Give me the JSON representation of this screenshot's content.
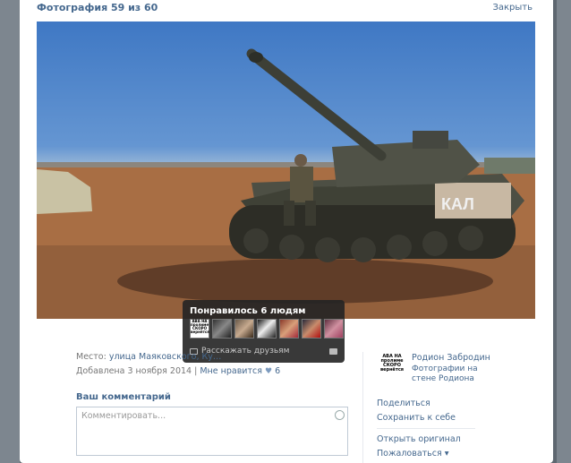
{
  "header": {
    "photo_counter": "Фотография 59 из 60",
    "close_label": "Закрыть"
  },
  "likes_popup": {
    "title": "Понравилось 6 людям",
    "share_label": "Расскажать друзьям",
    "first_avatar_text": "АВА НА пролиме СКОРО вернётся"
  },
  "info": {
    "place_prefix": "Место:",
    "place_value": "улица Маяковского, Ку…",
    "added_label": "Добавлена 3 ноября 2014",
    "separator": "|",
    "like_label": "Мне нравится",
    "like_count": "6"
  },
  "comment": {
    "heading": "Ваш комментарий",
    "placeholder": "Комментировать..."
  },
  "sidebar": {
    "author_name": "Родион Забродин",
    "album_label": "Фотографии на стене Родиона",
    "logo_text": "АВА НА пролиме СКОРО вернётся",
    "share_label": "Поделиться",
    "save_label": "Сохранить к себе",
    "open_original_label": "Открыть оригинал",
    "report_label": "Пожаловаться"
  }
}
